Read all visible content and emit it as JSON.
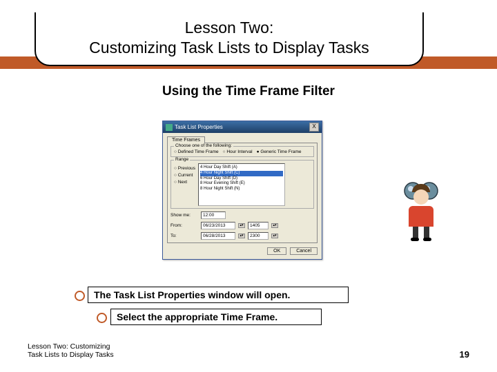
{
  "title": {
    "line1": "Lesson Two:",
    "line2": "Customizing Task Lists to Display Tasks"
  },
  "subtitle": "Using the Time Frame Filter",
  "dialog": {
    "window_title": "Task List Properties",
    "close_label": "X",
    "tab_label": "Time Frames",
    "choose_group": "Choose one of the following:",
    "opts": {
      "defined": "Defined Time Frame",
      "hour": "Hour Interval",
      "generic": "Generic Time Frame"
    },
    "range": {
      "previous": "Previous",
      "current": "Current",
      "next": "Next"
    },
    "listbox": [
      "4 Hour Day Shift (A)",
      "4 Hour Night Shift (C)",
      "6 Hour Day Shift (D)",
      "8 Hour Evening Shift (E)",
      "8 Hour Night Shift (N)"
    ],
    "shown_label": "Show me:",
    "shown_value": "12:00",
    "from_label": "From:",
    "from_date": "06/23/2013",
    "from_time": "1405",
    "to_label": "To:",
    "to_date": "06/28/2013",
    "to_time": "2300",
    "ok": "OK",
    "cancel": "Cancel"
  },
  "captions": {
    "c1": "The Task List Properties window will open.",
    "c2": "Select the appropriate Time Frame."
  },
  "footer": {
    "left_line1": "Lesson Two: Customizing",
    "left_line2": "Task Lists to Display Tasks",
    "page": "19"
  }
}
